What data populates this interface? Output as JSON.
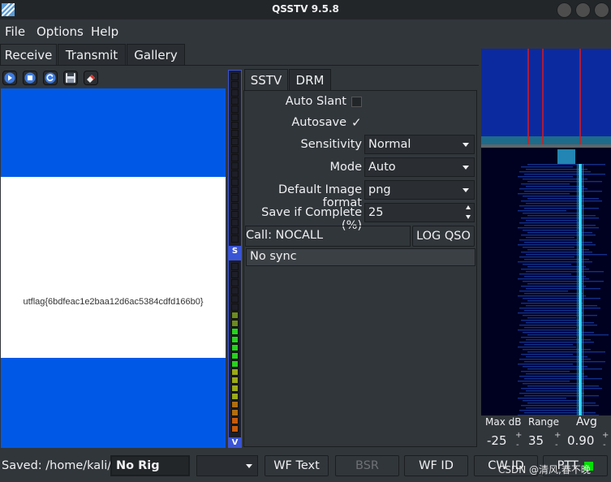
{
  "window": {
    "title": "QSSTV 9.5.8"
  },
  "menu": {
    "file": "File",
    "options": "Options",
    "help": "Help"
  },
  "tabs": {
    "receive": "Receive",
    "transmit": "Transmit",
    "gallery": "Gallery"
  },
  "toolbar_icons": [
    "start-icon",
    "stop-icon",
    "replay-icon",
    "save-icon",
    "erase-icon"
  ],
  "received_image": {
    "text": "utflag{6bdfeac1e2baa12d6ac5384cdfd166b0}",
    "band_color": "#0059e6"
  },
  "meters": {
    "sync_letter": "S",
    "volume_letter": "V"
  },
  "mode_tabs": {
    "sstv": "SSTV",
    "drm": "DRM"
  },
  "settings": {
    "auto_slant_label": "Auto Slant",
    "autosave_label": "Autosave",
    "autosave_check": "✓",
    "sensitivity_label": "Sensitivity",
    "sensitivity_value": "Normal",
    "mode_label": "Mode",
    "mode_value": "Auto",
    "image_format_label": "Default Image format",
    "image_format_value": "png",
    "save_if_complete_label": "Save if Complete (%)",
    "save_if_complete_value": "25",
    "call_text": "Call: NOCALL",
    "log_qso_label": "LOG QSO",
    "sync_status": "No sync"
  },
  "waterfall_controls": {
    "max_db_label": "Max dB",
    "max_db_value": "-25",
    "range_label": "Range",
    "range_value": "35",
    "avg_label": "Avg",
    "avg_value": "0.90",
    "plus": "+",
    "minus": "-"
  },
  "statusbar": {
    "saved_text": "Saved: /home/kali/q",
    "rig_value": "No Rig",
    "combo_value": "",
    "wf_text_label": "WF Text",
    "bsr_label": "BSR",
    "wf_id_label": "WF ID",
    "cw_id_label": "CW ID",
    "ptt_label": "PTT",
    "ptt_color": "#00e000"
  },
  "watermark": "CSDN @清风,春不晚"
}
